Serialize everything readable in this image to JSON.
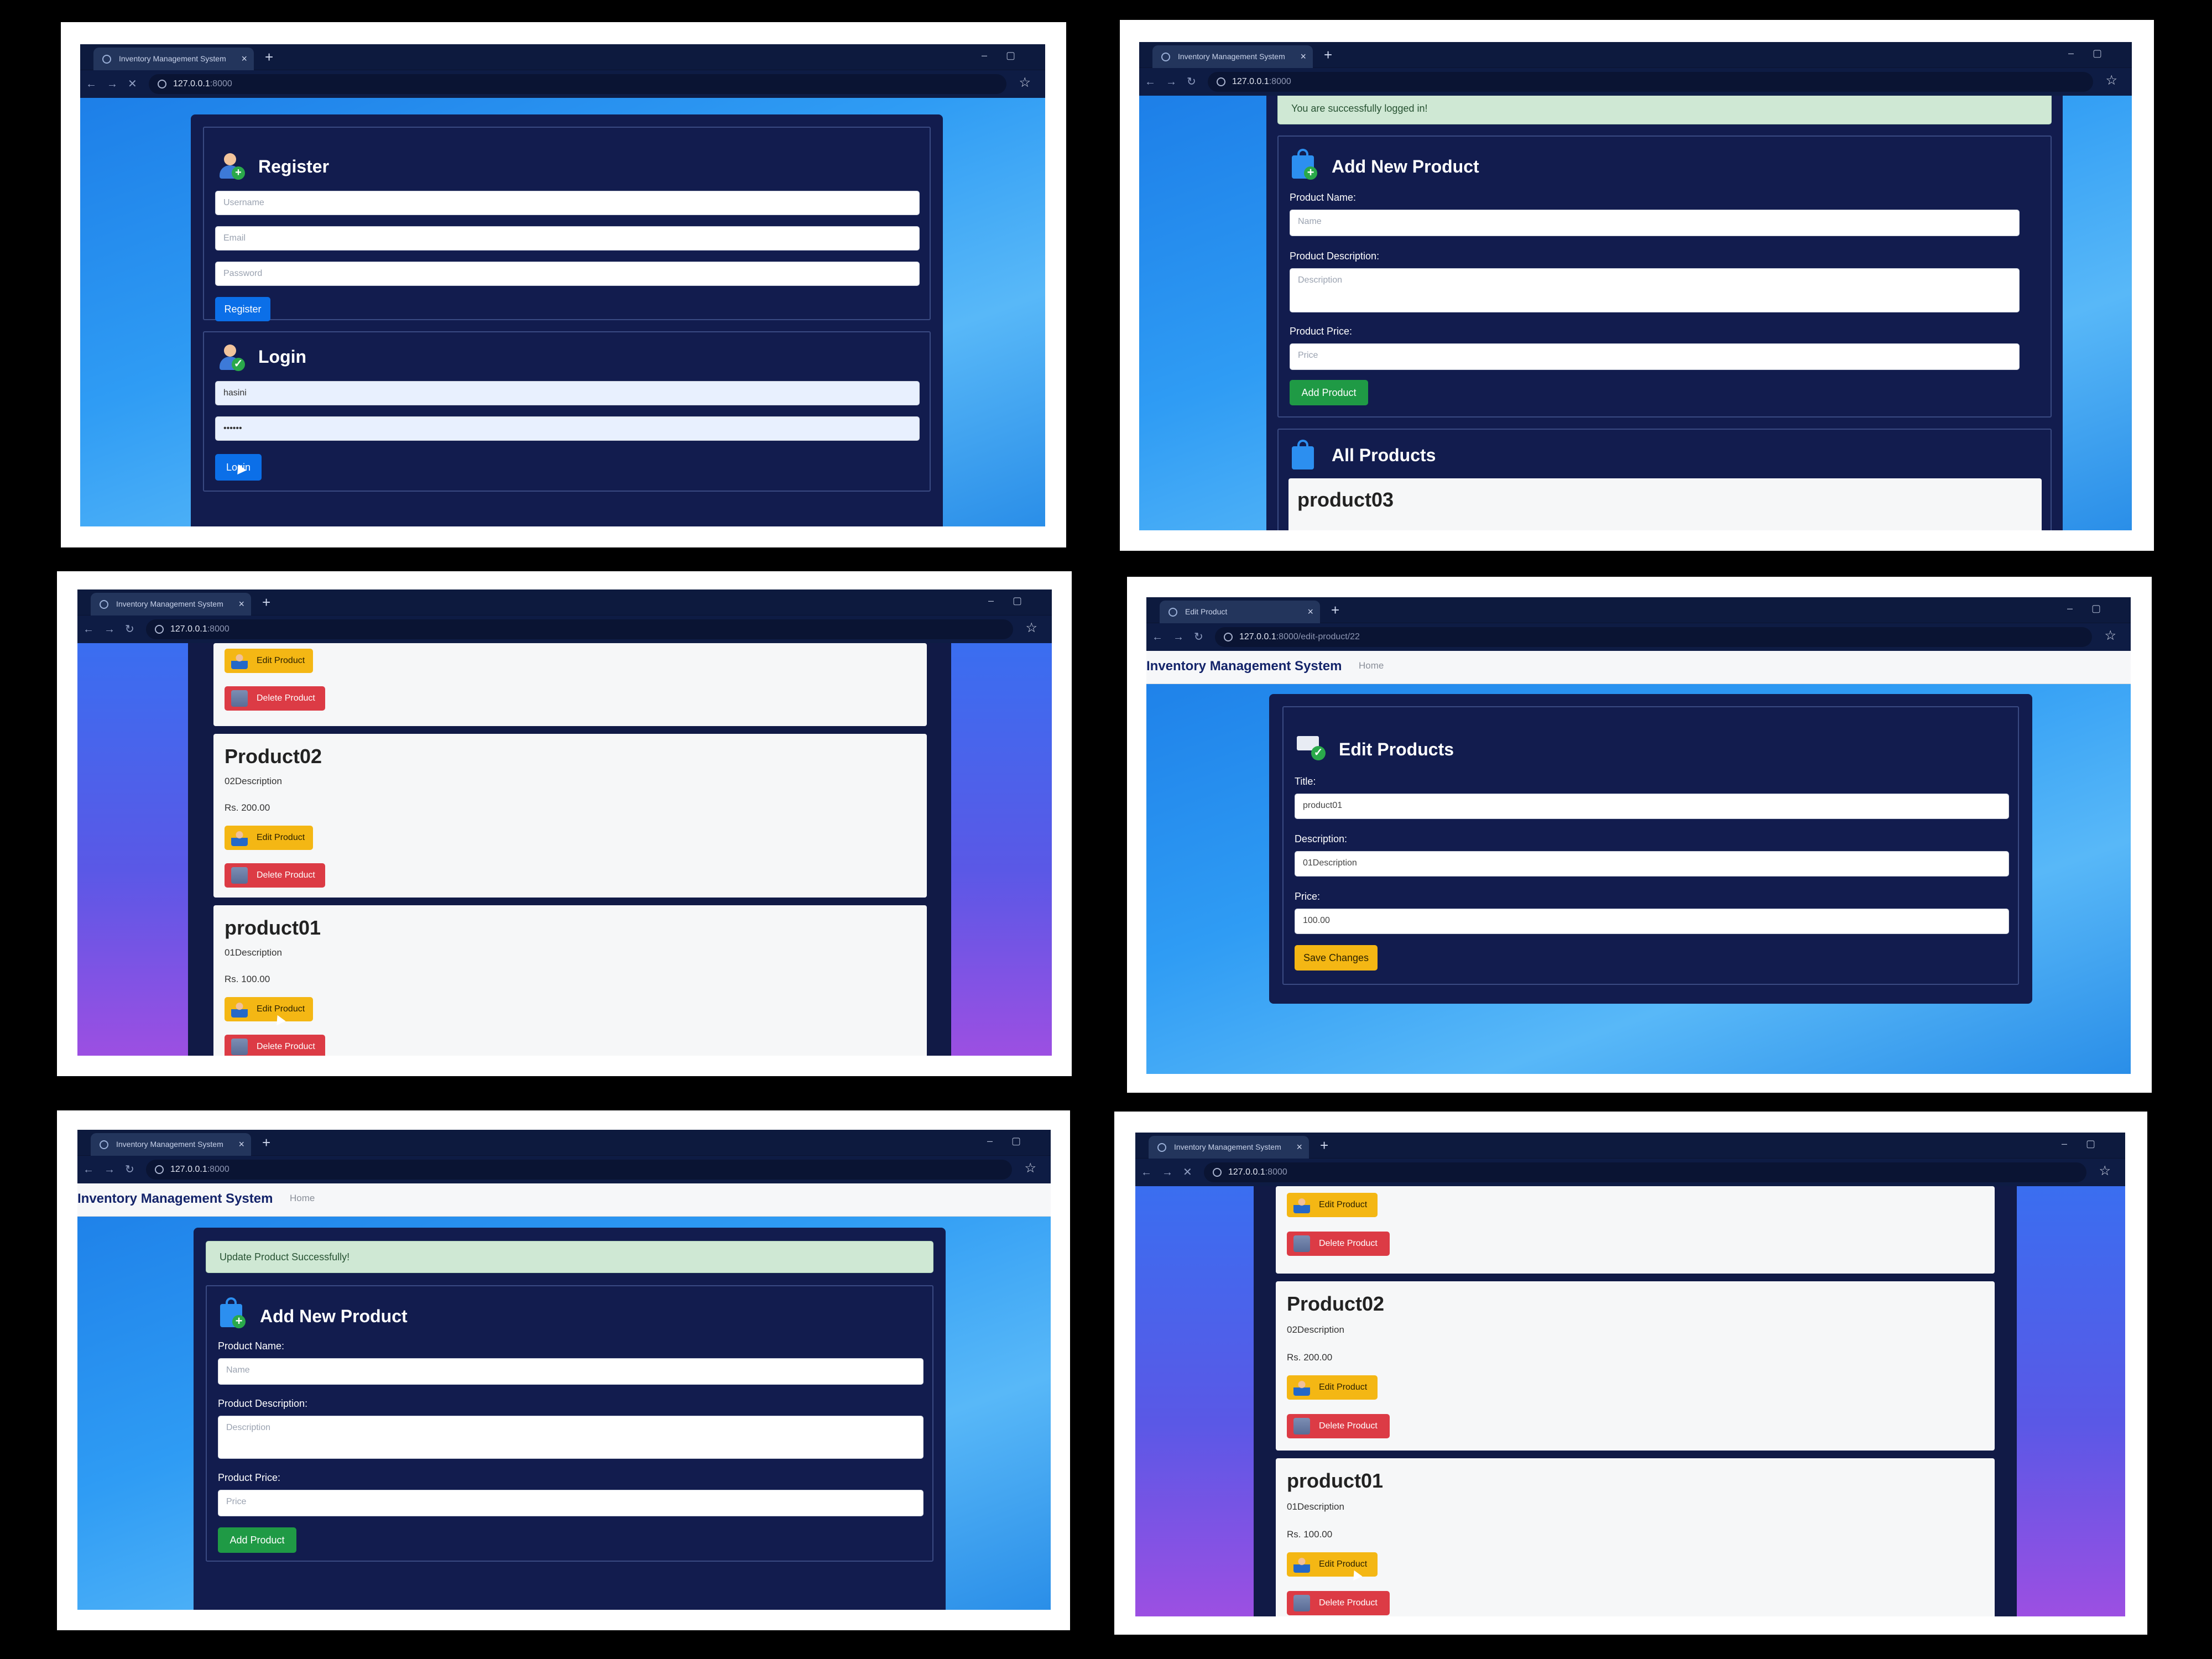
{
  "shots": {
    "s1": {
      "tab_title": "Inventory Management System",
      "url_host": "127.0.0.1",
      "url_rest": ":8000",
      "register": {
        "title": "Register",
        "username_placeholder": "Username",
        "email_placeholder": "Email",
        "password_placeholder": "Password",
        "button": "Register"
      },
      "login": {
        "title": "Login",
        "username_value": "hasini",
        "password_value": "••••••",
        "button": "Login"
      }
    },
    "s2": {
      "tab_title": "Inventory Management System",
      "url_host": "127.0.0.1",
      "url_rest": ":8000",
      "alert": "You are successfully logged in!",
      "add_title": "Add New Product",
      "name_label": "Product Name:",
      "name_placeholder": "Name",
      "desc_label": "Product Description:",
      "desc_placeholder": "Description",
      "price_label": "Product Price:",
      "price_placeholder": "Price",
      "add_button": "Add Product",
      "all_title": "All Products",
      "first_product": "product03"
    },
    "s3": {
      "tab_title": "Inventory Management System",
      "url_host": "127.0.0.1",
      "url_rest": ":8000",
      "edit_label": "Edit Product",
      "delete_label": "Delete Product",
      "products": [
        {
          "name": "Product02",
          "description": "02Description",
          "price": "Rs. 200.00"
        },
        {
          "name": "product01",
          "description": "01Description",
          "price": "Rs. 100.00"
        }
      ]
    },
    "s4": {
      "tab_title": "Edit Product",
      "url_host": "127.0.0.1",
      "url_rest": ":8000/edit-product/22",
      "brand": "Inventory Management System",
      "home": "Home",
      "edit_title": "Edit Products",
      "title_label": "Title:",
      "title_value": "product01",
      "desc_label": "Description:",
      "desc_value": "01Description",
      "price_label": "Price:",
      "price_value": "100.00",
      "save_button": "Save Changes"
    },
    "s5": {
      "tab_title": "Inventory Management System",
      "url_host": "127.0.0.1",
      "url_rest": ":8000",
      "brand": "Inventory Management System",
      "home": "Home",
      "alert": "Update Product Successfully!",
      "add_title": "Add New Product",
      "name_label": "Product Name:",
      "name_placeholder": "Name",
      "desc_label": "Product Description:",
      "desc_placeholder": "Description",
      "price_label": "Product Price:",
      "price_placeholder": "Price",
      "add_button": "Add Product"
    },
    "s6": {
      "tab_title": "Inventory Management System",
      "url_host": "127.0.0.1",
      "url_rest": ":8000",
      "edit_label": "Edit Product",
      "delete_label": "Delete Product",
      "products": [
        {
          "name": "Product02",
          "description": "02Description",
          "price": "Rs. 200.00"
        },
        {
          "name": "product01",
          "description": "01Description",
          "price": "Rs. 100.00"
        }
      ]
    }
  }
}
